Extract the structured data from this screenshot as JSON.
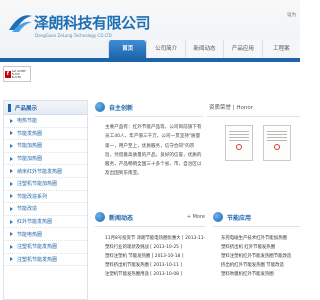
{
  "header": {
    "logo_text": "泽朗科技有限公司",
    "logo_sub": "DongGuan ZeLang Technology CO.LTD",
    "top_right": "设为"
  },
  "nav": {
    "items": [
      "首页",
      "公司简介",
      "新闻动态",
      "产品应用",
      "工程案"
    ]
  },
  "flash": {
    "line1": "Get ADOBE",
    "line2": "FLASH PLAYER"
  },
  "sidebar": {
    "title": "产品展示",
    "items": [
      "电热节能",
      "节能发热圈",
      "节能加热圈",
      "节能加热圈",
      "纳米红外节能发热圈",
      "注塑机节能加热圈",
      "节能改造系列",
      "节能改造",
      "红外节能发热圈",
      "节能电热圈",
      "注塑机节能发热圈",
      "注塑机节能发热圈"
    ]
  },
  "about": {
    "title": "自主创新",
    "text": "主要产品有：红外节能产品等。公司目前旗下有员工40人，年产值三千万。公司一贯坚持\"质量第一，用户至上，优质服务，信守合同\"的宗旨，凭借着高质量的产品，良好的信誉，优质的服务，产品畅销全国三十多个省，市，自治区以及出国到东南亚。"
  },
  "honor": {
    "title": "资质荣誉 | Honor"
  },
  "news": {
    "title": "新闻动态",
    "more": "+ More",
    "items": [
      "11月8号投资节 泽朗节能电热圈优惠大 [ 2013-11-08 ]",
      "塑料行业的现状及挑战 [ 2013-10-25 ]",
      "塑料注塑机 节能发热圈 [ 2013-10-18 ]",
      "塑料挤出机节能发热圈 [ 2013-10-11 ]",
      "注塑机节能发热圈用途 [ 2013-10-08 ]"
    ]
  },
  "apps": {
    "title": "节能应用",
    "items": [
      "东莞电磁生产技术红外节能加热圈",
      "塑料挤出机 红外节能发热圈",
      "塑料注塑机红外节能发热圈节能改造",
      "挤出机红外节能发热圈 节能改造",
      "塑料吹膜机红外节能发热圈"
    ]
  },
  "colors": {
    "brand_blue": "#1d64ad",
    "link_blue": "#2466a8"
  }
}
